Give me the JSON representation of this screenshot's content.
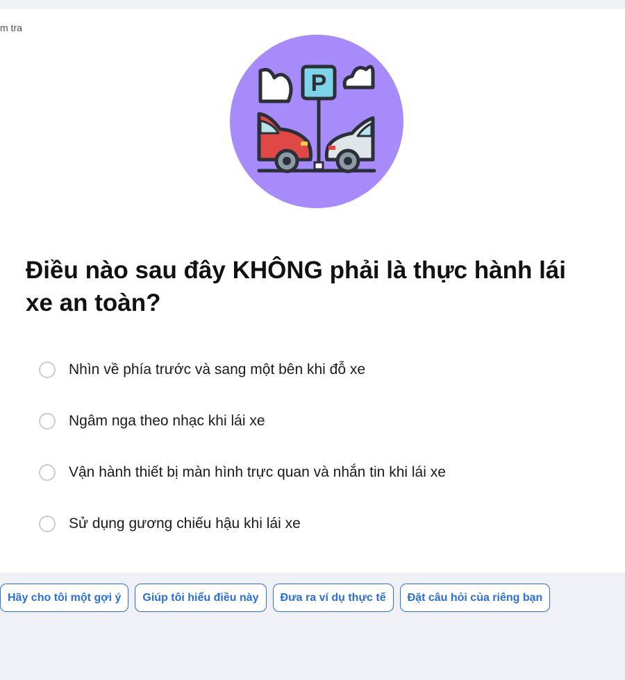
{
  "breadcrumb": {
    "text": "m tra"
  },
  "illustration": {
    "icon": "parking-lot-icon",
    "sign_letter": "P",
    "colors": {
      "circle": "#a78bfa",
      "sign": "#7dd3e8",
      "red_car": "#e04848",
      "white_car": "#dfe6ea",
      "outline": "#2b2f38"
    }
  },
  "question": {
    "text": "Điều nào sau đây KHÔNG phải là thực hành lái xe an toàn?"
  },
  "options": [
    {
      "label": "Nhìn về phía trước và sang một bên khi đỗ xe"
    },
    {
      "label": "Ngâm nga theo nhạc khi lái xe"
    },
    {
      "label": "Vận hành thiết bị màn hình trực quan và nhắn tin khi lái xe"
    },
    {
      "label": "Sử dụng gương chiếu hậu khi lái xe"
    }
  ],
  "suggestions": [
    {
      "label": "Hãy cho tôi một gợi ý"
    },
    {
      "label": "Giúp tôi hiểu điều này"
    },
    {
      "label": "Đưa ra ví dụ thực tế"
    },
    {
      "label": "Đặt câu hỏi của riêng bạn"
    }
  ],
  "colors": {
    "background": "#f0f1f6",
    "card": "#ffffff",
    "accent": "#2a6fd6",
    "radio_border": "#c9cad3"
  }
}
